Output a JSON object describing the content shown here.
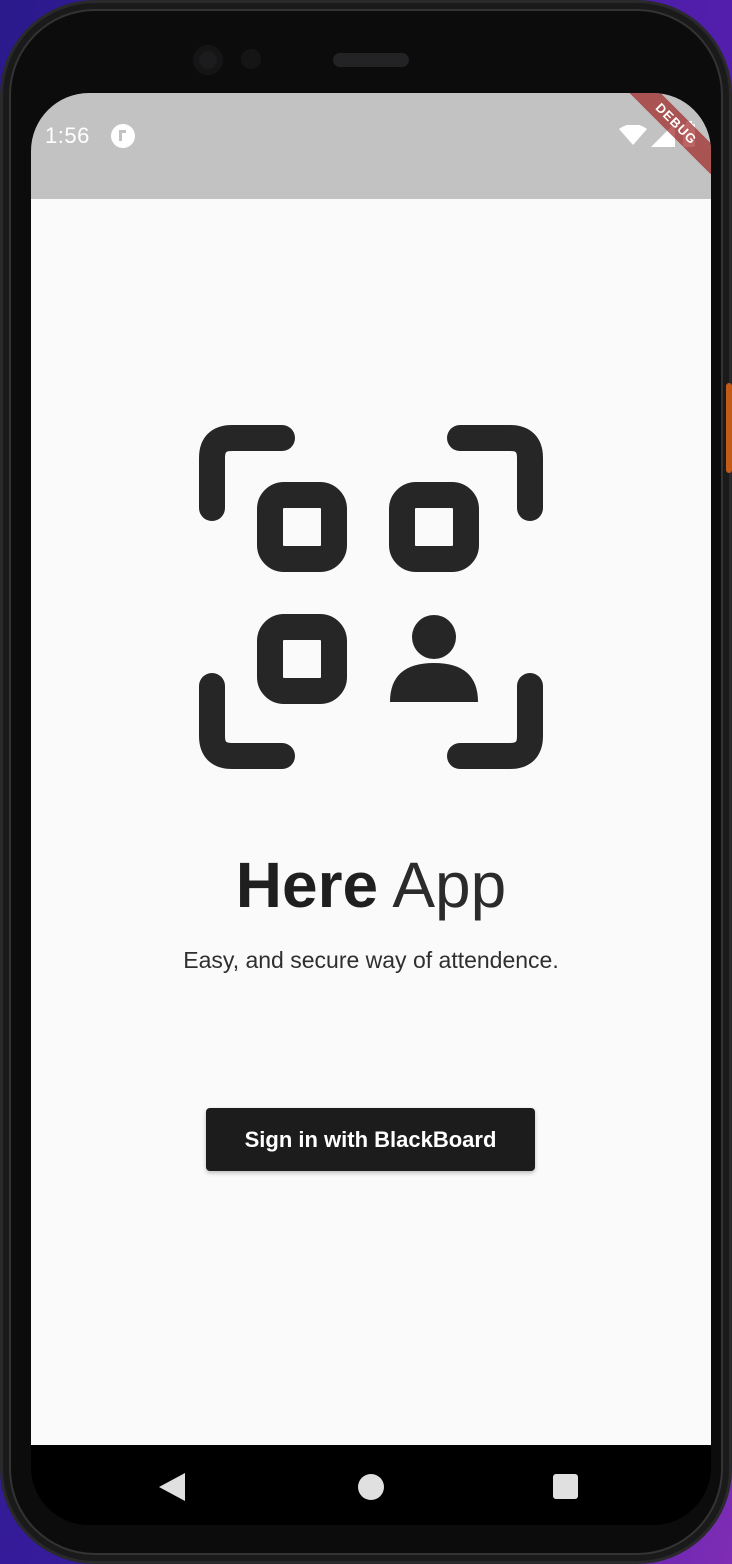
{
  "status_bar": {
    "time": "1:56",
    "notification_icon": "flutter-notification-icon",
    "wifi_icon": "wifi-icon",
    "signal_icon": "cell-signal-icon",
    "battery_icon": "battery-icon",
    "debug_banner": "DEBUG",
    "background_color": "#c2c2c2"
  },
  "app": {
    "logo_icon": "qr-code-person-scanner-icon",
    "title_bold": "Here",
    "title_light": "App",
    "subtitle": "Easy, and secure way of attendence.",
    "sign_in_button": "Sign in with BlackBoard",
    "background_color": "#fafafa",
    "accent_color": "#1c1c1c"
  },
  "nav_bar": {
    "back_icon": "back-triangle-icon",
    "home_icon": "home-circle-icon",
    "recents_icon": "recents-square-icon"
  }
}
